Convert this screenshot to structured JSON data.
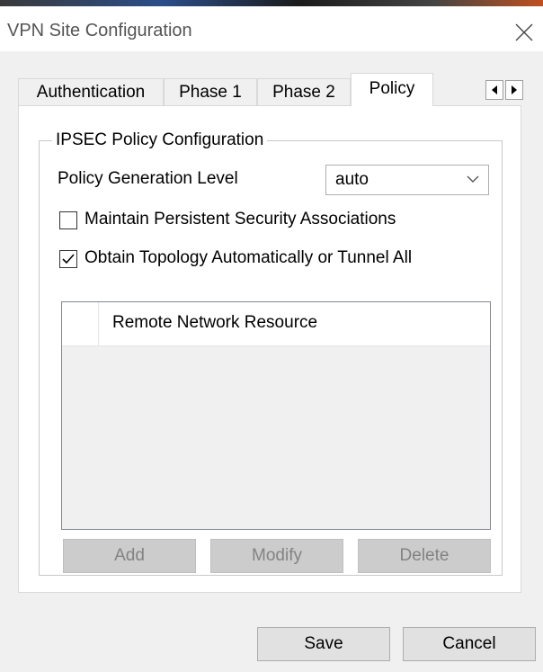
{
  "window": {
    "title": "VPN Site Configuration",
    "close_icon": "close-icon"
  },
  "tabs": [
    {
      "label": "Authentication",
      "active": false
    },
    {
      "label": "Phase 1",
      "active": false
    },
    {
      "label": "Phase 2",
      "active": false
    },
    {
      "label": "Policy",
      "active": true
    }
  ],
  "tab_scroll": {
    "left_icon": "arrow-left-icon",
    "right_icon": "arrow-right-icon"
  },
  "policy": {
    "group_title": "IPSEC Policy Configuration",
    "generation_level_label": "Policy Generation Level",
    "generation_level_value": "auto",
    "maintain_sa_label": "Maintain Persistent Security Associations",
    "maintain_sa_checked": false,
    "obtain_topology_label": "Obtain Topology Automatically or Tunnel All",
    "obtain_topology_checked": true,
    "list_column": "Remote Network Resource",
    "add_label": "Add",
    "modify_label": "Modify",
    "delete_label": "Delete"
  },
  "footer": {
    "save_label": "Save",
    "cancel_label": "Cancel"
  }
}
